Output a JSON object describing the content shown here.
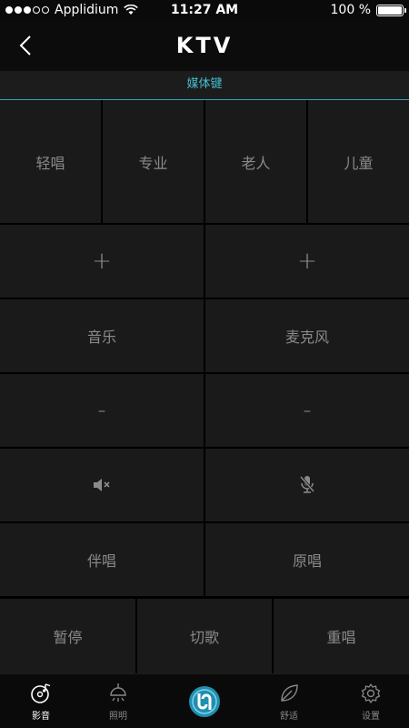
{
  "status": {
    "carrier": "Applidium",
    "time": "11:27 AM",
    "battery": "100 %"
  },
  "nav": {
    "title": "KTV"
  },
  "media_tab": {
    "label": "媒体键"
  },
  "modes": [
    "轻唱",
    "专业",
    "老人",
    "儿童"
  ],
  "volume": {
    "plus_left": "+",
    "plus_right": "+",
    "music_label": "音乐",
    "mic_label": "麦克风",
    "minus_left": "-",
    "minus_right": "-"
  },
  "vocal": {
    "accompany_label": "伴唱",
    "original_label": "原唱"
  },
  "controls": [
    "暂停",
    "切歌",
    "重唱"
  ],
  "tabs": [
    "影音",
    "照明",
    "",
    "舒适",
    "设置"
  ],
  "colors": {
    "accent": "#2aa7b3",
    "cell_bg": "#1a1a1a",
    "text": "#8a8a8a"
  }
}
